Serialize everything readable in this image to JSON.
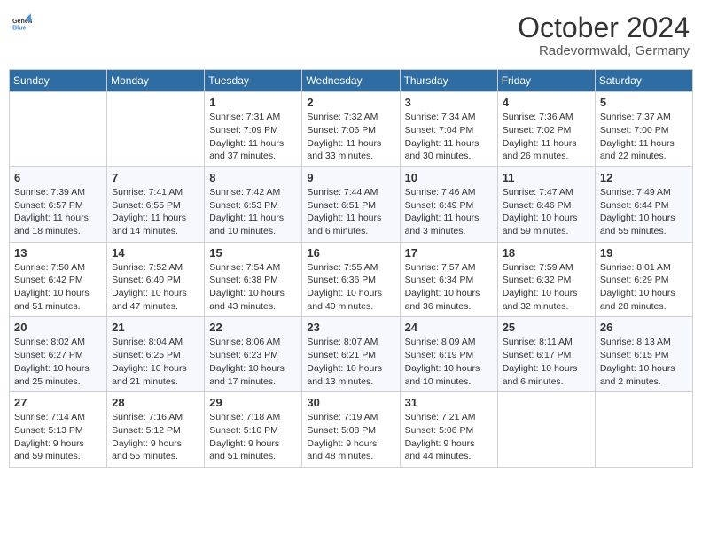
{
  "header": {
    "logo_general": "General",
    "logo_blue": "Blue",
    "month_title": "October 2024",
    "location": "Radevormwald, Germany"
  },
  "days_of_week": [
    "Sunday",
    "Monday",
    "Tuesday",
    "Wednesday",
    "Thursday",
    "Friday",
    "Saturday"
  ],
  "weeks": [
    [
      {
        "day": "",
        "sunrise": "",
        "sunset": "",
        "daylight": ""
      },
      {
        "day": "",
        "sunrise": "",
        "sunset": "",
        "daylight": ""
      },
      {
        "day": "1",
        "sunrise": "Sunrise: 7:31 AM",
        "sunset": "Sunset: 7:09 PM",
        "daylight": "Daylight: 11 hours and 37 minutes."
      },
      {
        "day": "2",
        "sunrise": "Sunrise: 7:32 AM",
        "sunset": "Sunset: 7:06 PM",
        "daylight": "Daylight: 11 hours and 33 minutes."
      },
      {
        "day": "3",
        "sunrise": "Sunrise: 7:34 AM",
        "sunset": "Sunset: 7:04 PM",
        "daylight": "Daylight: 11 hours and 30 minutes."
      },
      {
        "day": "4",
        "sunrise": "Sunrise: 7:36 AM",
        "sunset": "Sunset: 7:02 PM",
        "daylight": "Daylight: 11 hours and 26 minutes."
      },
      {
        "day": "5",
        "sunrise": "Sunrise: 7:37 AM",
        "sunset": "Sunset: 7:00 PM",
        "daylight": "Daylight: 11 hours and 22 minutes."
      }
    ],
    [
      {
        "day": "6",
        "sunrise": "Sunrise: 7:39 AM",
        "sunset": "Sunset: 6:57 PM",
        "daylight": "Daylight: 11 hours and 18 minutes."
      },
      {
        "day": "7",
        "sunrise": "Sunrise: 7:41 AM",
        "sunset": "Sunset: 6:55 PM",
        "daylight": "Daylight: 11 hours and 14 minutes."
      },
      {
        "day": "8",
        "sunrise": "Sunrise: 7:42 AM",
        "sunset": "Sunset: 6:53 PM",
        "daylight": "Daylight: 11 hours and 10 minutes."
      },
      {
        "day": "9",
        "sunrise": "Sunrise: 7:44 AM",
        "sunset": "Sunset: 6:51 PM",
        "daylight": "Daylight: 11 hours and 6 minutes."
      },
      {
        "day": "10",
        "sunrise": "Sunrise: 7:46 AM",
        "sunset": "Sunset: 6:49 PM",
        "daylight": "Daylight: 11 hours and 3 minutes."
      },
      {
        "day": "11",
        "sunrise": "Sunrise: 7:47 AM",
        "sunset": "Sunset: 6:46 PM",
        "daylight": "Daylight: 10 hours and 59 minutes."
      },
      {
        "day": "12",
        "sunrise": "Sunrise: 7:49 AM",
        "sunset": "Sunset: 6:44 PM",
        "daylight": "Daylight: 10 hours and 55 minutes."
      }
    ],
    [
      {
        "day": "13",
        "sunrise": "Sunrise: 7:50 AM",
        "sunset": "Sunset: 6:42 PM",
        "daylight": "Daylight: 10 hours and 51 minutes."
      },
      {
        "day": "14",
        "sunrise": "Sunrise: 7:52 AM",
        "sunset": "Sunset: 6:40 PM",
        "daylight": "Daylight: 10 hours and 47 minutes."
      },
      {
        "day": "15",
        "sunrise": "Sunrise: 7:54 AM",
        "sunset": "Sunset: 6:38 PM",
        "daylight": "Daylight: 10 hours and 43 minutes."
      },
      {
        "day": "16",
        "sunrise": "Sunrise: 7:55 AM",
        "sunset": "Sunset: 6:36 PM",
        "daylight": "Daylight: 10 hours and 40 minutes."
      },
      {
        "day": "17",
        "sunrise": "Sunrise: 7:57 AM",
        "sunset": "Sunset: 6:34 PM",
        "daylight": "Daylight: 10 hours and 36 minutes."
      },
      {
        "day": "18",
        "sunrise": "Sunrise: 7:59 AM",
        "sunset": "Sunset: 6:32 PM",
        "daylight": "Daylight: 10 hours and 32 minutes."
      },
      {
        "day": "19",
        "sunrise": "Sunrise: 8:01 AM",
        "sunset": "Sunset: 6:29 PM",
        "daylight": "Daylight: 10 hours and 28 minutes."
      }
    ],
    [
      {
        "day": "20",
        "sunrise": "Sunrise: 8:02 AM",
        "sunset": "Sunset: 6:27 PM",
        "daylight": "Daylight: 10 hours and 25 minutes."
      },
      {
        "day": "21",
        "sunrise": "Sunrise: 8:04 AM",
        "sunset": "Sunset: 6:25 PM",
        "daylight": "Daylight: 10 hours and 21 minutes."
      },
      {
        "day": "22",
        "sunrise": "Sunrise: 8:06 AM",
        "sunset": "Sunset: 6:23 PM",
        "daylight": "Daylight: 10 hours and 17 minutes."
      },
      {
        "day": "23",
        "sunrise": "Sunrise: 8:07 AM",
        "sunset": "Sunset: 6:21 PM",
        "daylight": "Daylight: 10 hours and 13 minutes."
      },
      {
        "day": "24",
        "sunrise": "Sunrise: 8:09 AM",
        "sunset": "Sunset: 6:19 PM",
        "daylight": "Daylight: 10 hours and 10 minutes."
      },
      {
        "day": "25",
        "sunrise": "Sunrise: 8:11 AM",
        "sunset": "Sunset: 6:17 PM",
        "daylight": "Daylight: 10 hours and 6 minutes."
      },
      {
        "day": "26",
        "sunrise": "Sunrise: 8:13 AM",
        "sunset": "Sunset: 6:15 PM",
        "daylight": "Daylight: 10 hours and 2 minutes."
      }
    ],
    [
      {
        "day": "27",
        "sunrise": "Sunrise: 7:14 AM",
        "sunset": "Sunset: 5:13 PM",
        "daylight": "Daylight: 9 hours and 59 minutes."
      },
      {
        "day": "28",
        "sunrise": "Sunrise: 7:16 AM",
        "sunset": "Sunset: 5:12 PM",
        "daylight": "Daylight: 9 hours and 55 minutes."
      },
      {
        "day": "29",
        "sunrise": "Sunrise: 7:18 AM",
        "sunset": "Sunset: 5:10 PM",
        "daylight": "Daylight: 9 hours and 51 minutes."
      },
      {
        "day": "30",
        "sunrise": "Sunrise: 7:19 AM",
        "sunset": "Sunset: 5:08 PM",
        "daylight": "Daylight: 9 hours and 48 minutes."
      },
      {
        "day": "31",
        "sunrise": "Sunrise: 7:21 AM",
        "sunset": "Sunset: 5:06 PM",
        "daylight": "Daylight: 9 hours and 44 minutes."
      },
      {
        "day": "",
        "sunrise": "",
        "sunset": "",
        "daylight": ""
      },
      {
        "day": "",
        "sunrise": "",
        "sunset": "",
        "daylight": ""
      }
    ]
  ]
}
